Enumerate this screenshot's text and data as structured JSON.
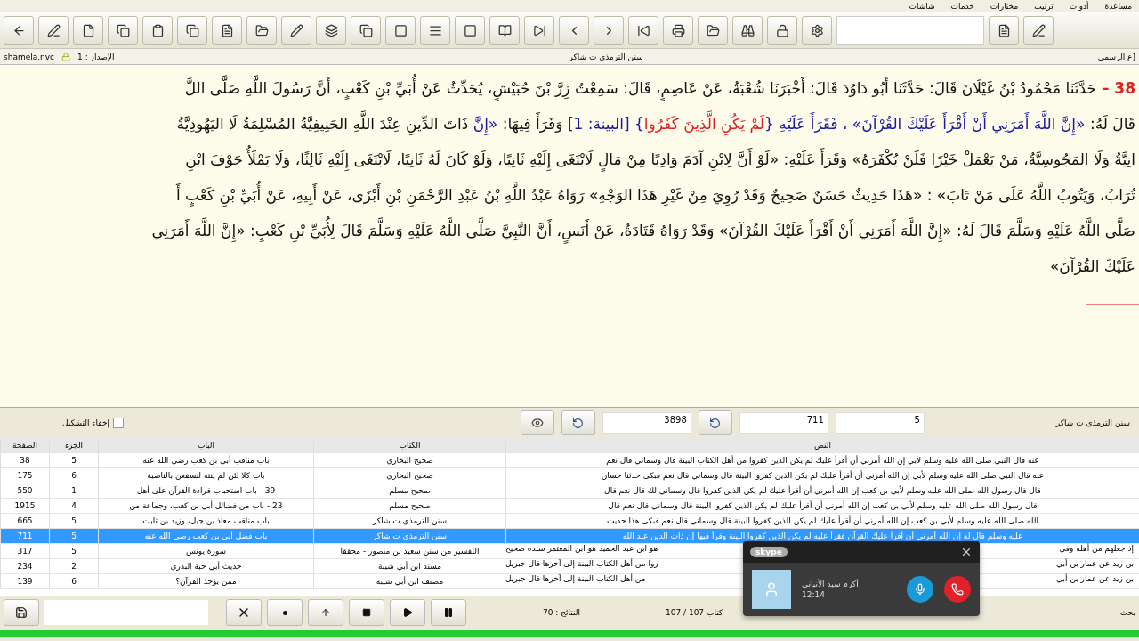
{
  "menu": [
    "مساعدة",
    "أدوات",
    "ترتيب",
    "مختارات",
    "خدمات",
    "شاشات"
  ],
  "info_bar": {
    "file": "shamela.nvc",
    "version": "الإصدار : 1",
    "book_title": "سنن الترمذي ت شاكر",
    "right_text": "ع الرسمي]"
  },
  "reader": {
    "number": "38 –",
    "lines": [
      [
        {
          "kind": "plain",
          "text": "حَدَّثَنَا مَحْمُودُ بْنُ غَيْلَانَ قَالَ: حَدَّثَنَا أَبُو دَاوُدَ قَالَ: أَخْبَرَنَا شُعْبَةُ، عَنْ عَاصِمٍ، قَالَ: سَمِعْتُ زِرَّ بْنَ حُبَيْشٍ، يُحَدِّثُ عَنْ أُبَيِّ بْنِ كَعْبٍ، أَنَّ رَسُولَ اللَّهِ صَلَّى اللَّ"
        }
      ],
      [
        {
          "kind": "plain",
          "text": "قَالَ لَهُ: "
        },
        {
          "kind": "quote",
          "text": "«إِنَّ اللَّهَ أَمَرَنِي أَنْ أَقْرَأَ عَلَيْكَ القُرْآنَ» ، فَقَرَأَ عَلَيْهِ {"
        },
        {
          "kind": "verse",
          "text": "لَمْ يَكُنِ الَّذِينَ كَفَرُوا"
        },
        {
          "kind": "quote",
          "text": "} [البينة: 1]"
        },
        {
          "kind": "plain",
          "text": " وَقَرَأَ فِيهَا: "
        },
        {
          "kind": "quote",
          "text": "«إِنَّ"
        },
        {
          "kind": "plain",
          "text": " ذَاتَ الدِّينِ عِنْدَ اللَّهِ الحَنِيفِيَّةُ المُسْلِمَةُ لَا اليَهُودِيَّةُ"
        }
      ],
      [
        {
          "kind": "plain",
          "text": "انِيَّةُ وَلَا المَجُوسِيَّةُ، مَنْ يَعْمَلْ خَيْرًا فَلَنْ يُكْفَرَهُ» وَقَرَأَ عَلَيْهِ: «لَوْ أَنَّ لِابْنِ آدَمَ وَادِيًا مِنْ مَالٍ لَابْتَغَى إِلَيْهِ ثَانِيًا، وَلَوْ كَانَ لَهُ ثَانِيًا، لَابْتَغَى إِلَيْهِ ثَالِثًا، وَلَا يَمْلَأُ جَوْفَ ابْنِ"
        }
      ],
      [
        {
          "kind": "plain",
          "text": "تُرَابُ، وَيَتُوبُ اللَّهُ عَلَى مَنْ تَابَ» : «هَذَا حَدِيثٌ حَسَنٌ صَحِيحٌ وَقَدْ رُوِيَ مِنْ غَيْرِ هَذَا الوَجْهِ» رَوَاهُ عَبْدُ اللَّهِ بْنُ عَبْدِ الرَّحْمَنِ بْنِ أَبْزَى، عَنْ أَبِيهِ، عَنْ أُبَيِّ بْنِ كَعْبٍ أَ"
        }
      ],
      [
        {
          "kind": "plain",
          "text": "صَلَّى اللَّهُ عَلَيْهِ وَسَلَّمَ قَالَ لَهُ: «إِنَّ اللَّهَ أَمَرَنِي أَنْ أَقْرَأَ عَلَيْكَ القُرْآنَ» وَقَدْ رَوَاهُ قَتَادَةُ، عَنْ أَنَسٍ، أَنَّ النَّبِيَّ صَلَّى اللَّهُ عَلَيْهِ وَسَلَّمَ قَالَ لِأُبَيِّ بْنِ كَعْبٍ: «إِنَّ اللَّهَ أَمَرَنِي"
        }
      ],
      [
        {
          "kind": "plain",
          "text": "عَلَيْكَ القُرْآنَ»"
        }
      ]
    ]
  },
  "search_bar": {
    "book": "سنن الترمذي ت شاكر",
    "part": "5",
    "page": "711",
    "total": "3898",
    "hide_diacritics": {
      "label": "إخفاء التشكيل",
      "checked": false
    }
  },
  "table": {
    "columns": [
      "النص",
      "الكتاب",
      "الباب",
      "الجزء",
      "الصفحة"
    ],
    "rows": [
      {
        "page": "38",
        "part": "5",
        "chapter": "باب مناقب أبي بن كعب رضي الله عنه",
        "book": "صحيح البخاري",
        "text": "عنه قال النبي صلى الله عليه وسلم لأبي إن الله أمرني أن أقرأ عليك لم يكن الذين كفروا من أهل الكتاب البينة قال وسماني قال نعم",
        "selected": false
      },
      {
        "page": "175",
        "part": "6",
        "chapter": "باب كلا لئن لم ينته لنسفعن بالناصية",
        "book": "صحيح البخاري",
        "text": "عنه قال النبي صلى الله عليه وسلم لأبي إن الله أمرني أن أقرأ عليك لم يكن الذين كفروا البينة قال وسماني قال نعم فبكى حدثنا حسان",
        "selected": false
      },
      {
        "page": "550",
        "part": "1",
        "chapter": "39 - باب استحباب قراءة القرآن على أهل",
        "book": "صحيح مسلم",
        "text": "قال قال رسول الله صلى الله عليه وسلم لأبي بن كعب إن الله أمرني أن أقرأ عليك لم يكن الذين كفروا قال وسماني لك قال نعم قال",
        "selected": false
      },
      {
        "page": "1915",
        "part": "4",
        "chapter": "23 - باب من فضائل أبي بن كعب، وجماعة من",
        "book": "صحيح مسلم",
        "text": "قال رسول الله صلى الله عليه وسلم لأبي بن كعب إن الله أمرني أن أقرأ عليك لم يكن الذين كفروا البينة قال وسماني قال نعم قال",
        "selected": false
      },
      {
        "page": "665",
        "part": "5",
        "chapter": "باب مناقب معاذ بن جبل، وزيد بن ثابت",
        "book": "سنن الترمذي ت شاكر",
        "text": "الله صلى الله عليه وسلم لأبي بن كعب إن الله أمرني أن أقرأ عليك لم يكن الذين كفروا البينة قال وسماني قال نعم فبكى هذا حديث",
        "selected": false
      },
      {
        "page": "711",
        "part": "5",
        "chapter": "باب فضل أبي بن كعب رضي الله عنه",
        "book": "سنن الترمذي ت شاكر",
        "text": "عليه وسلم قال له إن الله أمرني أن أقرأ عليك القرآن فقرأ عليه لم يكن الذين كفروا البينة وقرأ فيها إن ذات الدين عند الله",
        "selected": true
      },
      {
        "page": "317",
        "part": "5",
        "chapter": "سورة يونس",
        "book": "التفسير من سنن سعيد بن منصور - محققا",
        "text_parts": [
          "إذ جعلهم من أهله وفي",
          "هو ابن عبد الحميد هو ابن المعتمر سنده صحيح"
        ],
        "selected": false
      },
      {
        "page": "234",
        "part": "2",
        "chapter": "حديث أبي حبة البدري",
        "book": "مسند ابن أبي شيبة",
        "text_parts": [
          "بن زيد عن عمار بن أبي",
          "روا من أهل الكتاب البينة إلى آخرها قال جبريل"
        ],
        "selected": false
      },
      {
        "page": "139",
        "part": "6",
        "chapter": "ممن يؤخذ القرآن؟",
        "book": "مصنف ابن أبي شيبة",
        "text_parts": [
          "بن زيد عن عمار بن أبي",
          "من أهل الكتاب البينة إلى آخرها قال جبريل"
        ],
        "selected": false
      }
    ]
  },
  "status_bar": {
    "results": "النتائج : 70",
    "books": "كتاب 107 / 107",
    "search_label": "بحث",
    "progress": {
      "level": 1
    }
  },
  "call_popup": {
    "logo": "skype",
    "caller": "أكرم سيد الأنباني",
    "time": "12:14"
  }
}
